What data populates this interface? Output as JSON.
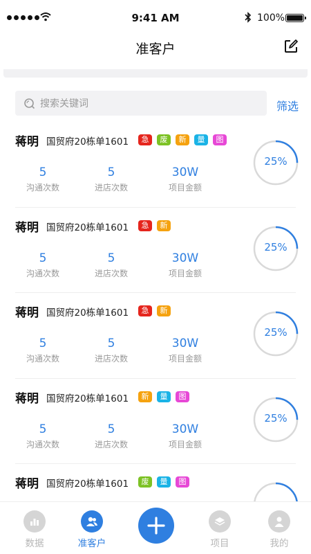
{
  "status_bar": {
    "time": "9:41 AM",
    "battery": "100%",
    "icons": [
      "signal-icon",
      "wifi-icon",
      "bluetooth-icon",
      "battery-icon"
    ]
  },
  "nav": {
    "title": "准客户",
    "edit_icon": "edit-icon"
  },
  "search": {
    "placeholder": "搜索关键词",
    "filter_label": "筛选"
  },
  "colors": {
    "accent": "#2f7fe0",
    "tag_urgent": "#e5251d",
    "tag_waste": "#7dc225",
    "tag_new": "#f5a20f",
    "tag_volume": "#1ab3e6",
    "tag_image": "#e748d6"
  },
  "stat_labels": {
    "communications": "沟通次数",
    "store_visits": "进店次数",
    "project_amount": "项目金额"
  },
  "customers": [
    {
      "name": "蒋明",
      "address": "国贸府20栋单1601",
      "tags": [
        {
          "text": "急",
          "color": "#e5251d"
        },
        {
          "text": "废",
          "color": "#7dc225"
        },
        {
          "text": "新",
          "color": "#f5a20f"
        },
        {
          "text": "量",
          "color": "#1ab3e6"
        },
        {
          "text": "图",
          "color": "#e748d6"
        }
      ],
      "communications": "5",
      "store_visits": "5",
      "project_amount": "30W",
      "progress_label": "25%",
      "progress": 0.25
    },
    {
      "name": "蒋明",
      "address": "国贸府20栋单1601",
      "tags": [
        {
          "text": "急",
          "color": "#e5251d"
        },
        {
          "text": "新",
          "color": "#f5a20f"
        }
      ],
      "communications": "5",
      "store_visits": "5",
      "project_amount": "30W",
      "progress_label": "25%",
      "progress": 0.25
    },
    {
      "name": "蒋明",
      "address": "国贸府20栋单1601",
      "tags": [
        {
          "text": "急",
          "color": "#e5251d"
        },
        {
          "text": "新",
          "color": "#f5a20f"
        }
      ],
      "communications": "5",
      "store_visits": "5",
      "project_amount": "30W",
      "progress_label": "25%",
      "progress": 0.25
    },
    {
      "name": "蒋明",
      "address": "国贸府20栋单1601",
      "tags": [
        {
          "text": "新",
          "color": "#f5a20f"
        },
        {
          "text": "量",
          "color": "#1ab3e6"
        },
        {
          "text": "图",
          "color": "#e748d6"
        }
      ],
      "communications": "5",
      "store_visits": "5",
      "project_amount": "30W",
      "progress_label": "25%",
      "progress": 0.25
    },
    {
      "name": "蒋明",
      "address": "国贸府20栋单1601",
      "tags": [
        {
          "text": "废",
          "color": "#7dc225"
        },
        {
          "text": "量",
          "color": "#1ab3e6"
        },
        {
          "text": "图",
          "color": "#e748d6"
        }
      ],
      "communications": "",
      "store_visits": "",
      "project_amount": "",
      "progress_label": "",
      "progress": 0.25
    }
  ],
  "tabbar": {
    "tabs": [
      {
        "label": "数据",
        "icon": "bar-chart-icon",
        "active": false
      },
      {
        "label": "准客户",
        "icon": "users-icon",
        "active": true
      },
      {
        "label": "项目",
        "icon": "layers-icon",
        "active": false
      },
      {
        "label": "我的",
        "icon": "user-icon",
        "active": false
      }
    ],
    "add_icon": "plus-icon"
  }
}
